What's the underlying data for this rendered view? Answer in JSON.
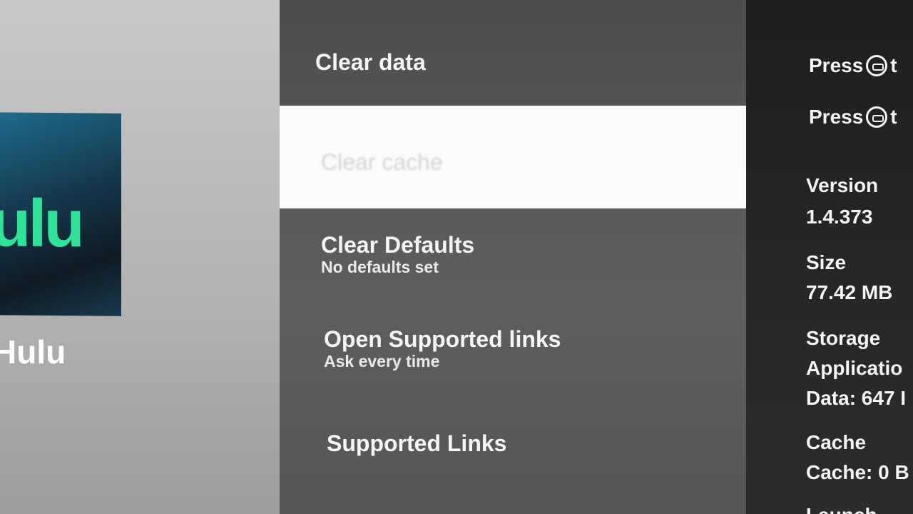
{
  "app": {
    "tile_logo": "ulu",
    "name": "Hulu"
  },
  "menu": {
    "items": [
      {
        "title": "Clear data",
        "subtitle": ""
      },
      {
        "title": "Clear cache",
        "subtitle": ""
      },
      {
        "title": "Clear Defaults",
        "subtitle": "No defaults set"
      },
      {
        "title": "Open Supported links",
        "subtitle": "Ask every time"
      },
      {
        "title": "Supported Links",
        "subtitle": ""
      }
    ]
  },
  "info": {
    "hint_1": "Press",
    "hint_1_suffix": "t",
    "hint_2": "Press",
    "hint_2_suffix": "t",
    "version_label": "Version",
    "version_value": "1.4.373",
    "size_label": "Size",
    "size_value": "77.42 MB",
    "storage_label": "Storage",
    "storage_line_1": "Applicatio",
    "storage_line_2": "Data: 647 I",
    "cache_label": "Cache",
    "cache_value": "Cache: 0 B",
    "launch_label": "Launch"
  },
  "colors": {
    "selected_background": "#fbfbfb",
    "app_logo_green": "#2fe39a"
  }
}
